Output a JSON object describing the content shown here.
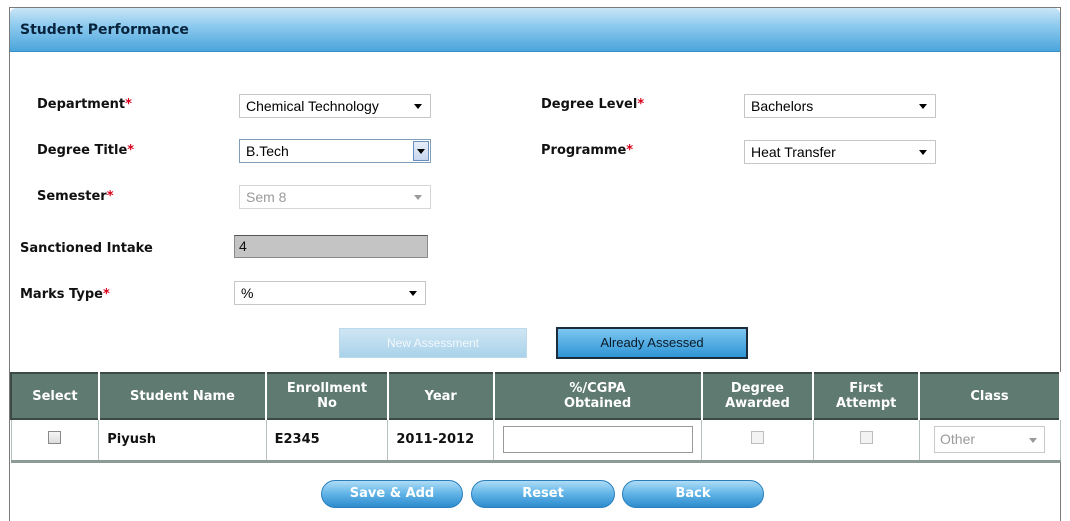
{
  "page": {
    "title": "Student Performance"
  },
  "form": {
    "department": {
      "label": "Department",
      "required": "*",
      "value": "Chemical Technology"
    },
    "degree_level": {
      "label": "Degree Level",
      "required": "*",
      "value": "Bachelors"
    },
    "degree_title": {
      "label": "Degree Title",
      "required": "*",
      "value": "B.Tech"
    },
    "programme": {
      "label": "Programme",
      "required": "*",
      "value": "Heat Transfer"
    },
    "semester": {
      "label": "Semester",
      "required": "*",
      "value": "Sem 8"
    },
    "sanctioned_intake": {
      "label": "Sanctioned Intake",
      "value": "4"
    },
    "marks_type": {
      "label": "Marks Type",
      "required": "*",
      "value": "%"
    }
  },
  "buttons": {
    "new_assessment": "New Assessment",
    "already_assessed": "Already Assessed",
    "save_add": "Save & Add",
    "reset": "Reset",
    "back": "Back"
  },
  "table": {
    "headers": {
      "select": "Select",
      "student_name": "Student Name",
      "enrollment_1": "Enrollment",
      "enrollment_2": "No",
      "year": "Year",
      "cgpa_1": "%/CGPA",
      "cgpa_2": "Obtained",
      "degree_1": "Degree",
      "degree_2": "Awarded",
      "first_1": "First",
      "first_2": "Attempt",
      "class": "Class"
    },
    "rows": [
      {
        "student_name": "Piyush",
        "enrollment_no": "E2345",
        "year": "2011-2012",
        "cgpa": "",
        "class": "Other"
      }
    ]
  },
  "colors": {
    "header_bar": "#4aa5dc",
    "table_header": "#5f7a70",
    "required_mark": "#d8001a",
    "pill_button": "#2d8bcd"
  }
}
